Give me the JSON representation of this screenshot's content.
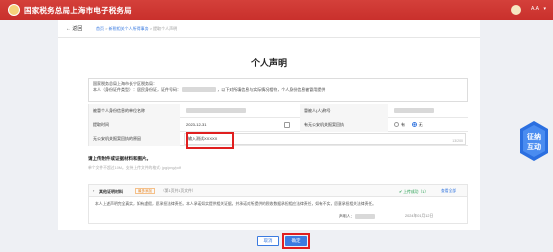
{
  "header": {
    "brand": "国家税务总局上海市电子税务局",
    "user_name": "A.A"
  },
  "breadcrumb": {
    "back": "返回",
    "items": [
      "首页",
      "新税相关个人所得事务",
      "提取个人声明"
    ]
  },
  "page": {
    "title": "个人声明",
    "declaration_line1": "国家税务总局上海市长宁区税务局：",
    "declaration_line2": "本人（身份证件类型）：居民身份证，证件号码：",
    "declaration_tail": "，以下对所填信息与实际情况相符，个人身份信息被冒用提供"
  },
  "form": {
    "r1_label": "被冒个人身份信息的单位名称",
    "r1_label2": "冒被人(人)称号",
    "r2_label": "提取时间",
    "r2_value": "2023-12-31",
    "r2_label2": "有无公安机关报案回执",
    "radio_yes": "有",
    "radio_no": "无",
    "r3_label": "无公安机关报案回执的原因",
    "r3_value": "输入测试XXXXX",
    "r3_count": "13/200"
  },
  "attachments": {
    "title": "请上传附件或证据材料和图片。",
    "hint": "单个文件不超过10M。支持上传文件的格式: jpg/png/pdf",
    "name": "其他证明材料",
    "tag": "最多添加",
    "pages": "（第1页共1页文件）",
    "status": "上传成功（1）",
    "view": "查看全部",
    "body": "本人上述声明完全真实，如有虚假，愿承担法律责任。本人承诺如实提供相关证据，并承诺对所提供的税收数据承担相应法律责任，如有不实，愿意承担相关法律责任。",
    "signer_label": "声明人：",
    "date": "2024年01月12日"
  },
  "footer": {
    "cancel": "取消",
    "confirm": "确定"
  },
  "badge": {
    "text": "征纳互动"
  },
  "colors": {
    "brand": "#c9302c",
    "accent": "#3b7be0",
    "highlight": "#e01f1f"
  }
}
